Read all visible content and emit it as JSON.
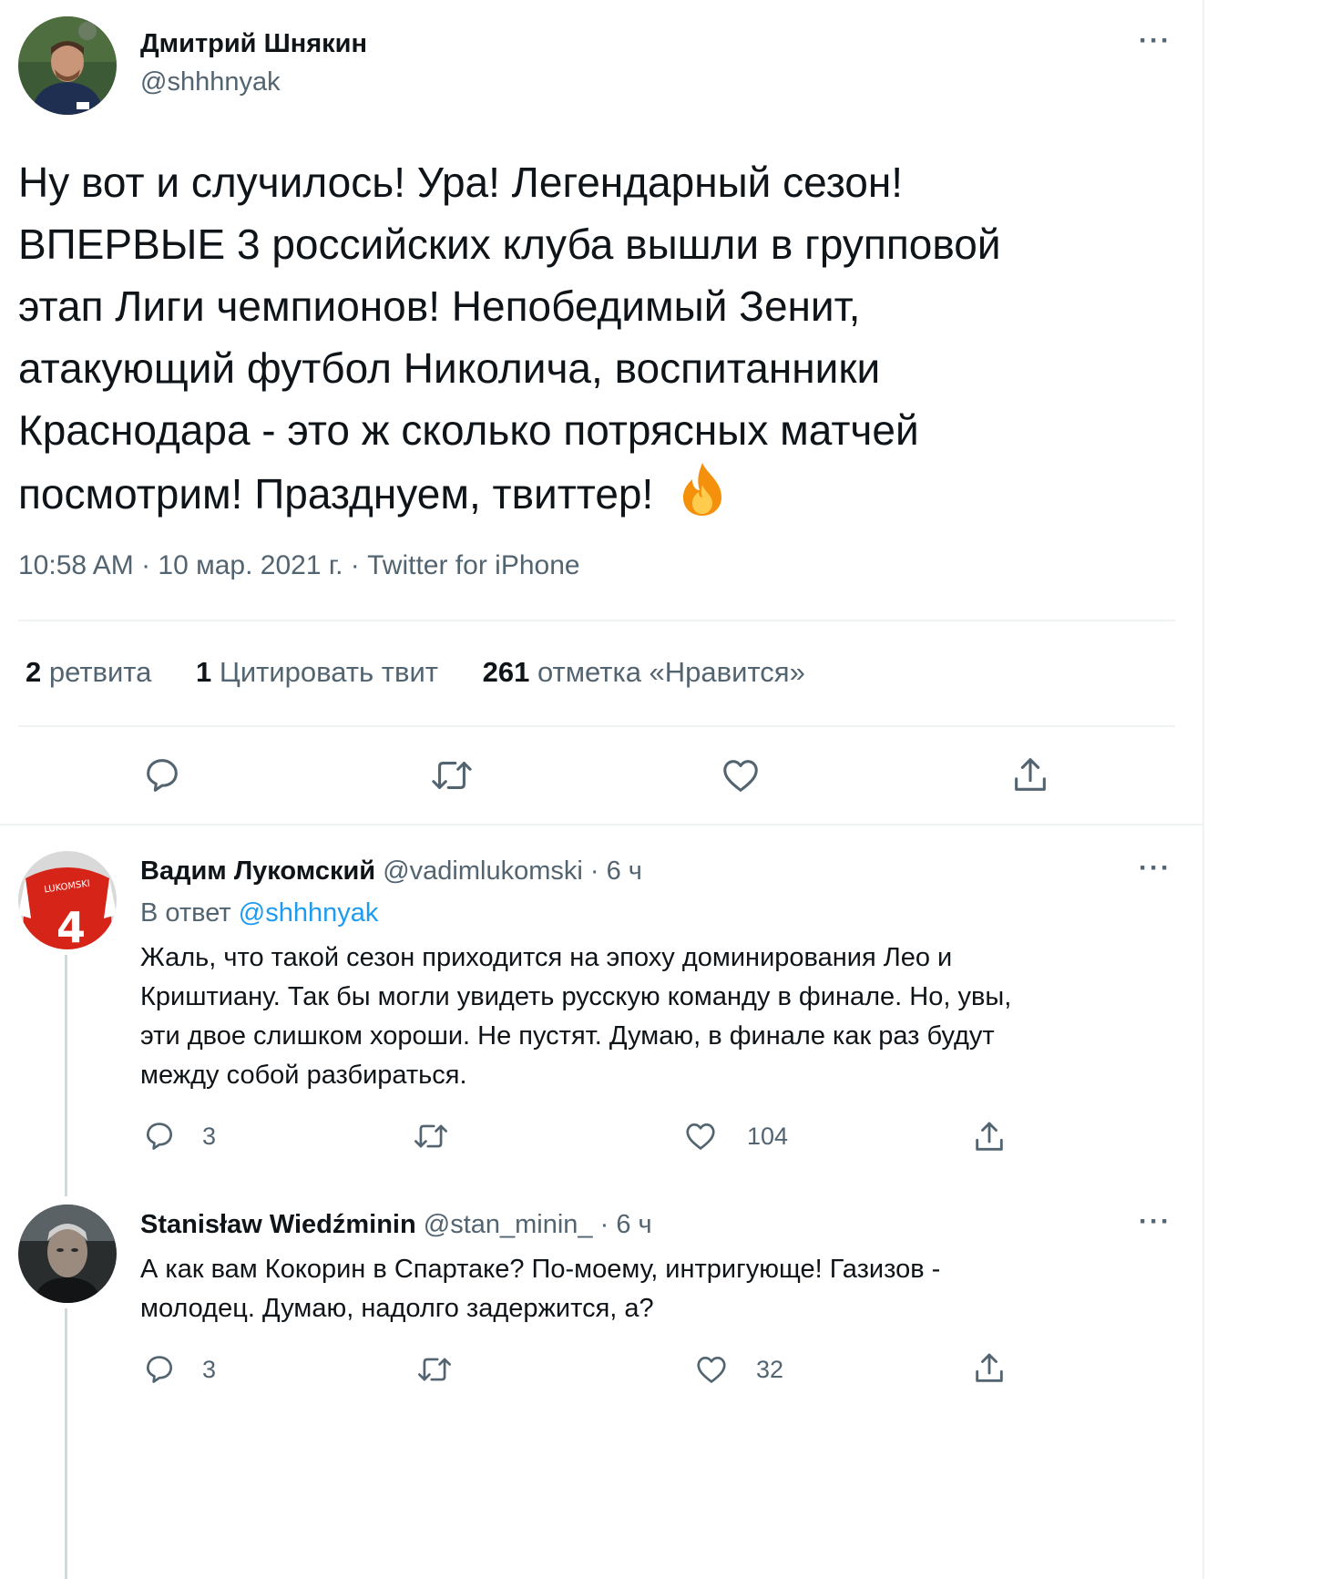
{
  "main_tweet": {
    "author_name": "Дмитрий Шнякин",
    "author_handle": "@shhhnyak",
    "text_lines": [
      "Ну вот и случилось! Ура! Легендарный сезон!",
      "ВПЕРВЫЕ 3 российских клуба вышли в групповой",
      "этап Лиги чемпионов! Непобедимый Зенит,",
      "атакующий футбол Николича, воспитанники",
      "Краснодара - это ж сколько потрясных матчей",
      "посмотрим! Празднуем, твиттер!"
    ],
    "emoji": "fire",
    "meta": "10:58 AM · 10 мар. 2021 г. · Twitter for iPhone",
    "stats": {
      "retweets_count": "2",
      "retweets_label": "ретвита",
      "quotes_count": "1",
      "quotes_label": "Цитировать твит",
      "likes_count": "261",
      "likes_label": "отметка «Нравится»"
    },
    "actions": [
      "reply-icon",
      "retweet-icon",
      "like-icon",
      "share-icon"
    ]
  },
  "replies": [
    {
      "author_name": "Вадим Лукомский",
      "author_handle": "@vadimlukomski",
      "time": "· 6 ч",
      "reply_to_prefix": "В ответ",
      "reply_to_handle": "@shhhnyak",
      "text_lines": [
        "Жаль, что такой сезон приходится на эпоху доминирования Лео и",
        "Криштиану. Так бы могли увидеть русскую команду в финале. Но, увы,",
        "эти двое слишком хороши. Не пустят. Думаю, в финале как раз будут",
        "между собой разбираться."
      ],
      "reply_count": "3",
      "like_count": "104",
      "avatar_shirt_text": "LUKOMSKI",
      "avatar_shirt_number": "4"
    },
    {
      "author_name": "Stanisław Wiedźminin",
      "author_handle": "@stan_minin_",
      "time": "· 6 ч",
      "text_lines": [
        "А как вам Кокорин в Спартаке? По-моему, интригующе! Газизов -",
        "молодец. Думаю, надолго задержится, а?"
      ],
      "reply_count": "3",
      "like_count": "32"
    }
  ],
  "colors": {
    "text": "#0f1419",
    "muted": "#536471",
    "link": "#1d9bf0",
    "divider": "#eff3f4"
  }
}
